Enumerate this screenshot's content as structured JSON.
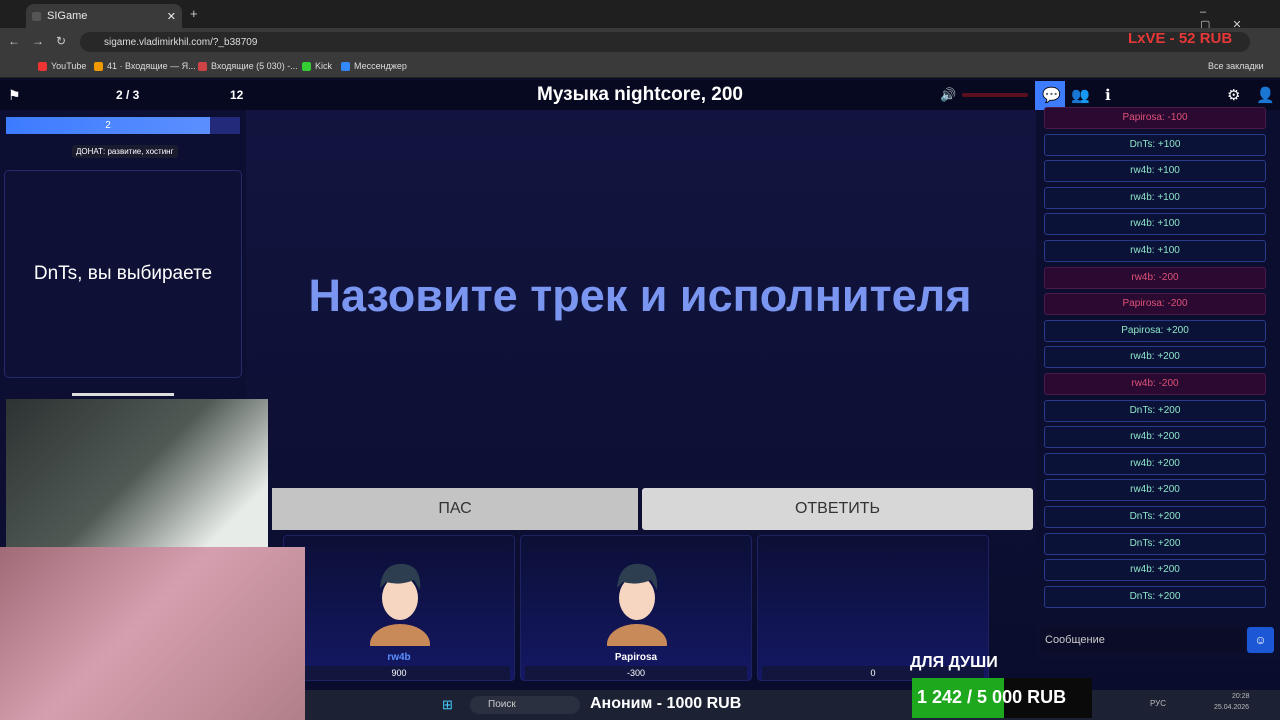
{
  "browser": {
    "tab_title": "SIGame",
    "url": "sigame.vladimirkhil.com/?_b38709",
    "all_bookmarks": "Все закладки",
    "bookmarks": [
      "YouTube",
      "41 · Входящие — Я...",
      "Входящие (5 030) -...",
      "Kick",
      "Мессенджер"
    ]
  },
  "game": {
    "round": "2 / 3",
    "count": "12",
    "title": "Музыка nightcore, 200",
    "progress_value": "2",
    "donate_label": "ДОНАТ: развитие, хостинг",
    "chooser_text": "DnTs, вы выбираете",
    "question": "Назовите трек и исполнителя",
    "pass_label": "ПАС",
    "answer_label": "ОТВЕТИТЬ",
    "players": [
      {
        "name": "rw4b",
        "score": "900"
      },
      {
        "name": "Papirosa",
        "score": "-300"
      },
      {
        "name": "",
        "score": "0"
      }
    ]
  },
  "chat": {
    "input_placeholder": "Сообщение",
    "messages": [
      {
        "text": "Papirosa: -100",
        "neg": true
      },
      {
        "text": "DnTs: +100",
        "neg": false
      },
      {
        "text": "rw4b: +100",
        "neg": false
      },
      {
        "text": "rw4b: +100",
        "neg": false
      },
      {
        "text": "rw4b: +100",
        "neg": false
      },
      {
        "text": "rw4b: +100",
        "neg": false
      },
      {
        "text": "rw4b: -200",
        "neg": true
      },
      {
        "text": "Papirosa: -200",
        "neg": true
      },
      {
        "text": "Papirosa: +200",
        "neg": false
      },
      {
        "text": "rw4b: +200",
        "neg": false
      },
      {
        "text": "rw4b: -200",
        "neg": true
      },
      {
        "text": "DnTs: +200",
        "neg": false
      },
      {
        "text": "rw4b: +200",
        "neg": false
      },
      {
        "text": "rw4b: +200",
        "neg": false
      },
      {
        "text": "rw4b: +200",
        "neg": false
      },
      {
        "text": "DnTs: +200",
        "neg": false
      },
      {
        "text": "DnTs: +200",
        "neg": false
      },
      {
        "text": "rw4b: +200",
        "neg": false
      },
      {
        "text": "DnTs: +200",
        "neg": false
      }
    ]
  },
  "stream": {
    "rub_top": "LxVE - 52 RUB",
    "goal_title": "ДЛЯ ДУШИ",
    "goal_value": "1 242 / 5 000 RUB",
    "ticker": "Аноним - 1000 RUB",
    "search": "Поиск",
    "lang": "РУС",
    "date": "25.04.2026",
    "time": "20:28"
  }
}
